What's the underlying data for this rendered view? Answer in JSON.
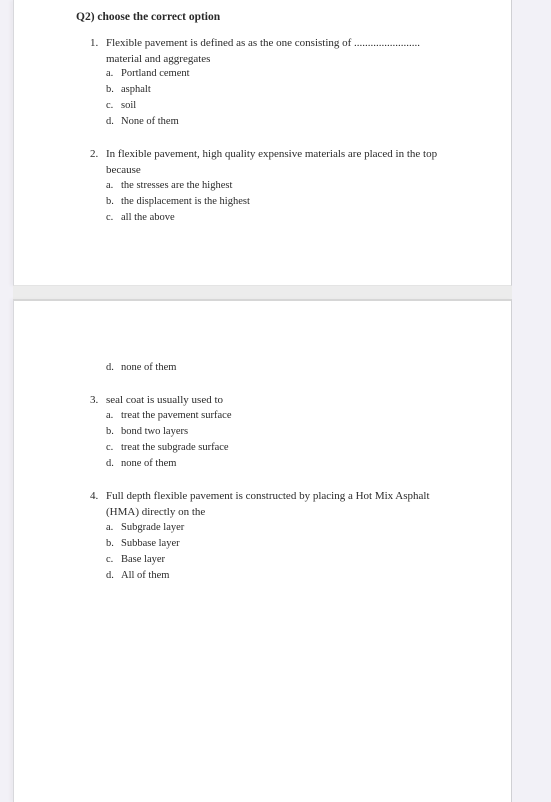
{
  "heading": "Q2) choose the correct option",
  "questions": [
    {
      "num": "1.",
      "text_line1": "Flexible pavement is defined as as the one consisting of ........................",
      "text_line2": "material and aggregates",
      "options": [
        {
          "letter": "a.",
          "text": "Portland cement"
        },
        {
          "letter": "b.",
          "text": "asphalt"
        },
        {
          "letter": "c.",
          "text": "soil"
        },
        {
          "letter": "d.",
          "text": "None of them"
        }
      ]
    },
    {
      "num": "2.",
      "text_line1": "In flexible pavement, high quality expensive materials are placed in the top",
      "text_line2": "because",
      "options": [
        {
          "letter": "a.",
          "text": "the stresses are the highest"
        },
        {
          "letter": "b.",
          "text": "the displacement is the highest"
        },
        {
          "letter": "c.",
          "text": "all the above"
        },
        {
          "letter": "d.",
          "text": "none of them"
        }
      ]
    },
    {
      "num": "3.",
      "text_line1": "seal coat is usually used to",
      "options": [
        {
          "letter": "a.",
          "text": "treat the pavement surface"
        },
        {
          "letter": "b.",
          "text": "bond two layers"
        },
        {
          "letter": "c.",
          "text": "treat the subgrade surface"
        },
        {
          "letter": "d.",
          "text": "none of them"
        }
      ]
    },
    {
      "num": "4.",
      "text_line1": "Full depth flexible pavement is constructed by placing a Hot Mix Asphalt",
      "text_line2": "(HMA) directly on the",
      "options": [
        {
          "letter": "a.",
          "text": "Subgrade layer"
        },
        {
          "letter": "b.",
          "text": "Subbase layer"
        },
        {
          "letter": "c.",
          "text": "Base layer"
        },
        {
          "letter": "d.",
          "text": "All of them"
        }
      ]
    }
  ]
}
